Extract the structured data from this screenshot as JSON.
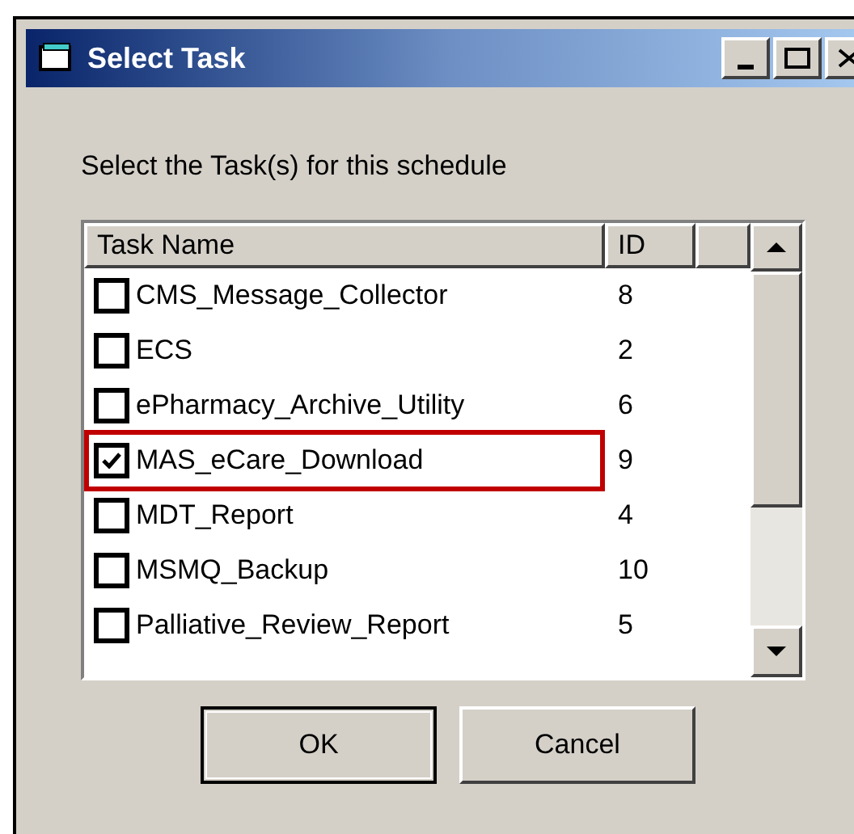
{
  "window": {
    "title": "Select Task"
  },
  "prompt": "Select the Task(s) for this schedule",
  "list": {
    "columns": [
      "Task Name",
      "ID"
    ],
    "rows": [
      {
        "name": "CMS_Message_Collector",
        "id": "8",
        "checked": false,
        "highlighted": false
      },
      {
        "name": "ECS",
        "id": "2",
        "checked": false,
        "highlighted": false
      },
      {
        "name": "ePharmacy_Archive_Utility",
        "id": "6",
        "checked": false,
        "highlighted": false
      },
      {
        "name": "MAS_eCare_Download",
        "id": "9",
        "checked": true,
        "highlighted": true
      },
      {
        "name": "MDT_Report",
        "id": "4",
        "checked": false,
        "highlighted": false
      },
      {
        "name": "MSMQ_Backup",
        "id": "10",
        "checked": false,
        "highlighted": false
      },
      {
        "name": "Palliative_Review_Report",
        "id": "5",
        "checked": false,
        "highlighted": false
      }
    ]
  },
  "buttons": [
    {
      "label": "OK",
      "default": true
    },
    {
      "label": "Cancel",
      "default": false
    }
  ]
}
